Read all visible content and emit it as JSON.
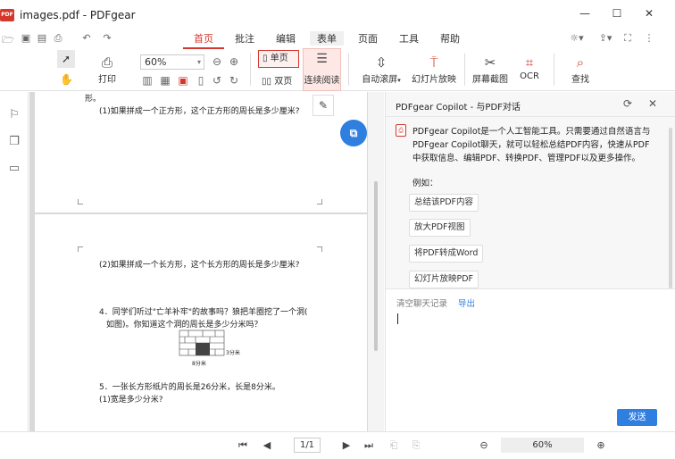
{
  "window": {
    "title": "images.pdf - PDFgear",
    "logo_text": "PDF"
  },
  "menu": {
    "tabs": [
      "首页",
      "批注",
      "编辑",
      "表单",
      "页面",
      "工具",
      "帮助"
    ]
  },
  "ribbon": {
    "print_label": "打印",
    "zoom_value": "60%",
    "single_page_label": "单页",
    "double_page_label": "双页",
    "continuous_label": "连续阅读",
    "auto_scroll_label": "自动滚屏",
    "slideshow_label": "幻灯片放映",
    "screenshot_label": "屏幕截图",
    "ocr_label": "OCR",
    "find_label": "查找"
  },
  "document": {
    "page1_frag": "形。",
    "page1_q1": "(1)如果拼成一个正方形，这个正方形的周长是多少厘米?",
    "page2_q2": "(2)如果拼成一个长方形，这个长方形的周长是多少厘米?",
    "page2_q4_line1": "4．同学们听过\"亡羊补牢\"的故事吗？狼把羊圈挖了一个洞(",
    "page2_q4_line2": "如图)。你知道这个洞的周长是多少分米吗？",
    "page2_fig_label1": "3分米",
    "page2_fig_label2": "8分米",
    "page2_q5_line1": "5．一张长方形纸片的周长是26分米，长是8分米。",
    "page2_q5_line2": "(1)宽是多少分米?"
  },
  "copilot": {
    "title": "PDFgear Copilot - 与PDF对话",
    "intro_lines": [
      "PDFgear Copilot是一个人工智能工具。只需要通过自然语言与",
      "PDFgear Copilot聊天，就可以轻松总结PDF内容，快速从PDF",
      "中获取信息、编辑PDF、转换PDF、管理PDF以及更多操作。"
    ],
    "example_label": "例如：",
    "suggestions": [
      "总结该PDF内容",
      "放大PDF视图",
      "将PDF转成Word",
      "幻灯片放映PDF"
    ],
    "clear_label": "清空聊天记录",
    "export_label": "导出",
    "send_label": "发送"
  },
  "statusbar": {
    "page_indicator": "1/1",
    "zoom_value": "60%"
  },
  "colors": {
    "accent": "#d4382c",
    "primary_blue": "#2f7fe0"
  }
}
